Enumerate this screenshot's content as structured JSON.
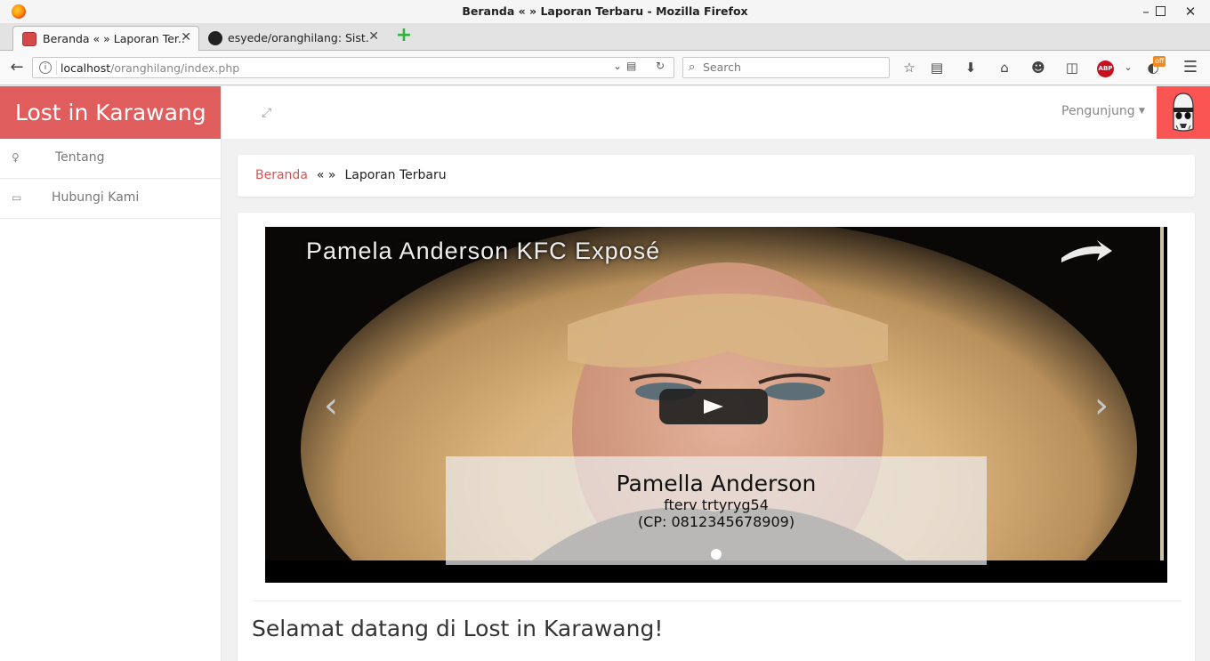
{
  "browser": {
    "window_title": "Beranda « » Laporan Terbaru - Mozilla Firefox",
    "tabs": [
      {
        "label": "Beranda « » Laporan Ter...",
        "active": true
      },
      {
        "label": "esyede/oranghilang: Sist...",
        "active": false
      }
    ],
    "url_host": "localhost",
    "url_path": "/oranghilang/index.php",
    "search_placeholder": "Search",
    "abp_label": "ABP",
    "off_badge": "off"
  },
  "sidebar": {
    "brand": "Lost in Karawang",
    "items": [
      {
        "label": "Tentang",
        "icon": "lightbulb-icon"
      },
      {
        "label": "Hubungi Kami",
        "icon": "inbox-icon"
      }
    ]
  },
  "topbar": {
    "user_menu": "Pengunjung"
  },
  "breadcrumb": {
    "home": "Beranda",
    "separator": "« »",
    "current": "Laporan Terbaru"
  },
  "carousel": {
    "photo_title": "Pamela Anderson KFC Exposé",
    "caption_name": "Pamella Anderson",
    "caption_desc": "fterv trtyryg54",
    "caption_cp": "(CP: 0812345678909)"
  },
  "main": {
    "welcome": "Selamat datang di Lost in Karawang!"
  },
  "colors": {
    "brand": "#e05d5d",
    "avatar_bg": "#fa5453",
    "link": "#d95555"
  }
}
